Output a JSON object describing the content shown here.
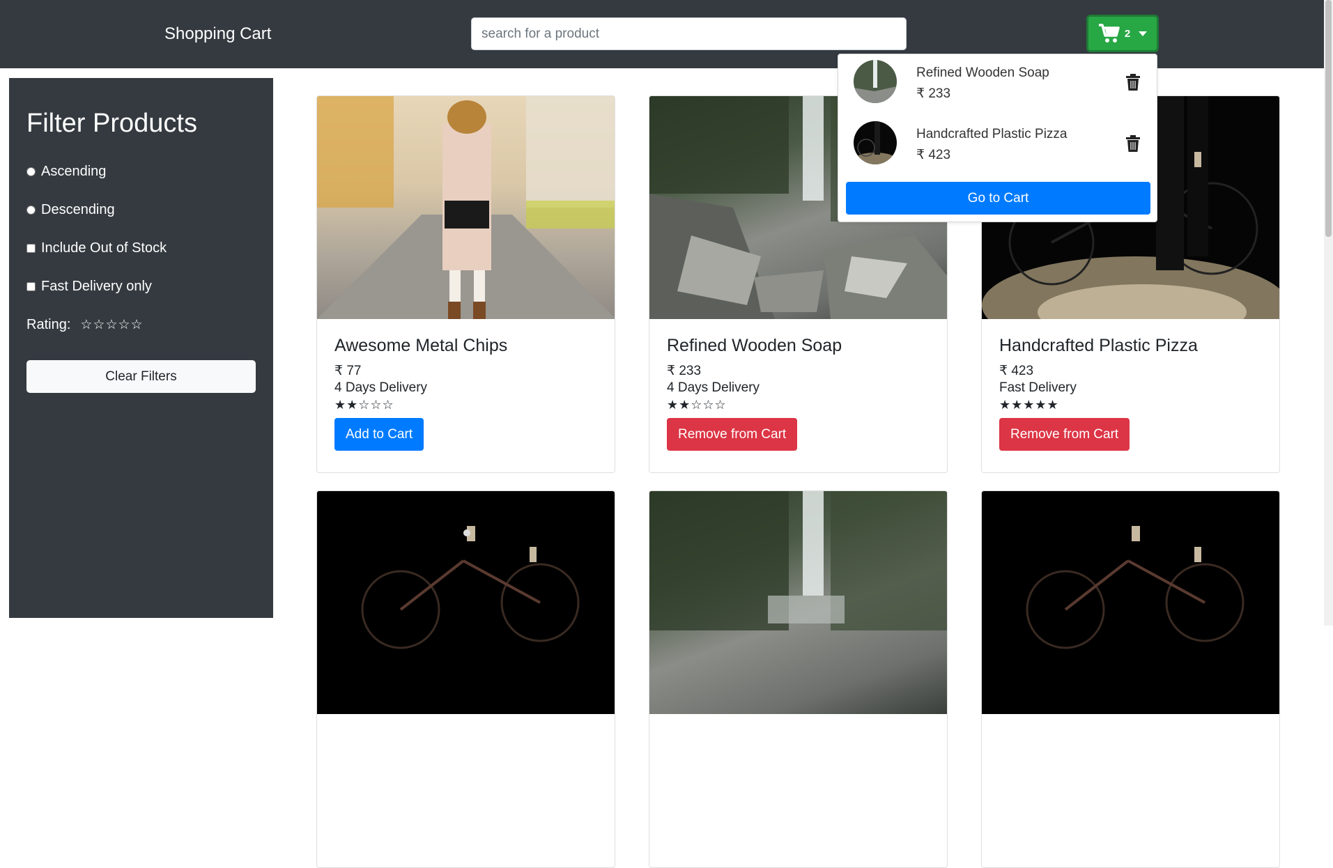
{
  "header": {
    "brand": "Shopping Cart",
    "search_placeholder": "search for a product",
    "cart_count": "2"
  },
  "sidebar": {
    "title": "Filter Products",
    "options": [
      {
        "label": "Ascending",
        "type": "radio"
      },
      {
        "label": "Descending",
        "type": "radio"
      },
      {
        "label": "Include Out of Stock",
        "type": "checkbox"
      },
      {
        "label": "Fast Delivery only",
        "type": "checkbox"
      }
    ],
    "rating_label": "Rating:",
    "rating_stars": "☆☆☆☆☆",
    "clear_label": "Clear Filters"
  },
  "products": [
    {
      "title": "Awesome Metal Chips",
      "price": "₹ 77",
      "delivery": "4 Days Delivery",
      "stars": "★★☆☆☆",
      "rating": 2,
      "button": "Add to Cart"
    },
    {
      "title": "Refined Wooden Soap",
      "price": "₹ 233",
      "delivery": "4 Days Delivery",
      "stars": "★★☆☆☆",
      "rating": 2,
      "button": "Remove from Cart"
    },
    {
      "title": "Handcrafted Plastic Pizza",
      "price": "₹ 423",
      "delivery": "Fast Delivery",
      "stars": "★★★★★",
      "rating": 5,
      "button": "Remove from Cart"
    }
  ],
  "cart_dropdown": {
    "items": [
      {
        "name": "Refined Wooden Soap",
        "price": "₹ 233"
      },
      {
        "name": "Handcrafted Plastic Pizza",
        "price": "₹ 423"
      }
    ],
    "go_to_cart": "Go to Cart"
  },
  "colors": {
    "navbar": "#343a40",
    "primary": "#007bff",
    "danger": "#dc3545",
    "success": "#28a745"
  }
}
